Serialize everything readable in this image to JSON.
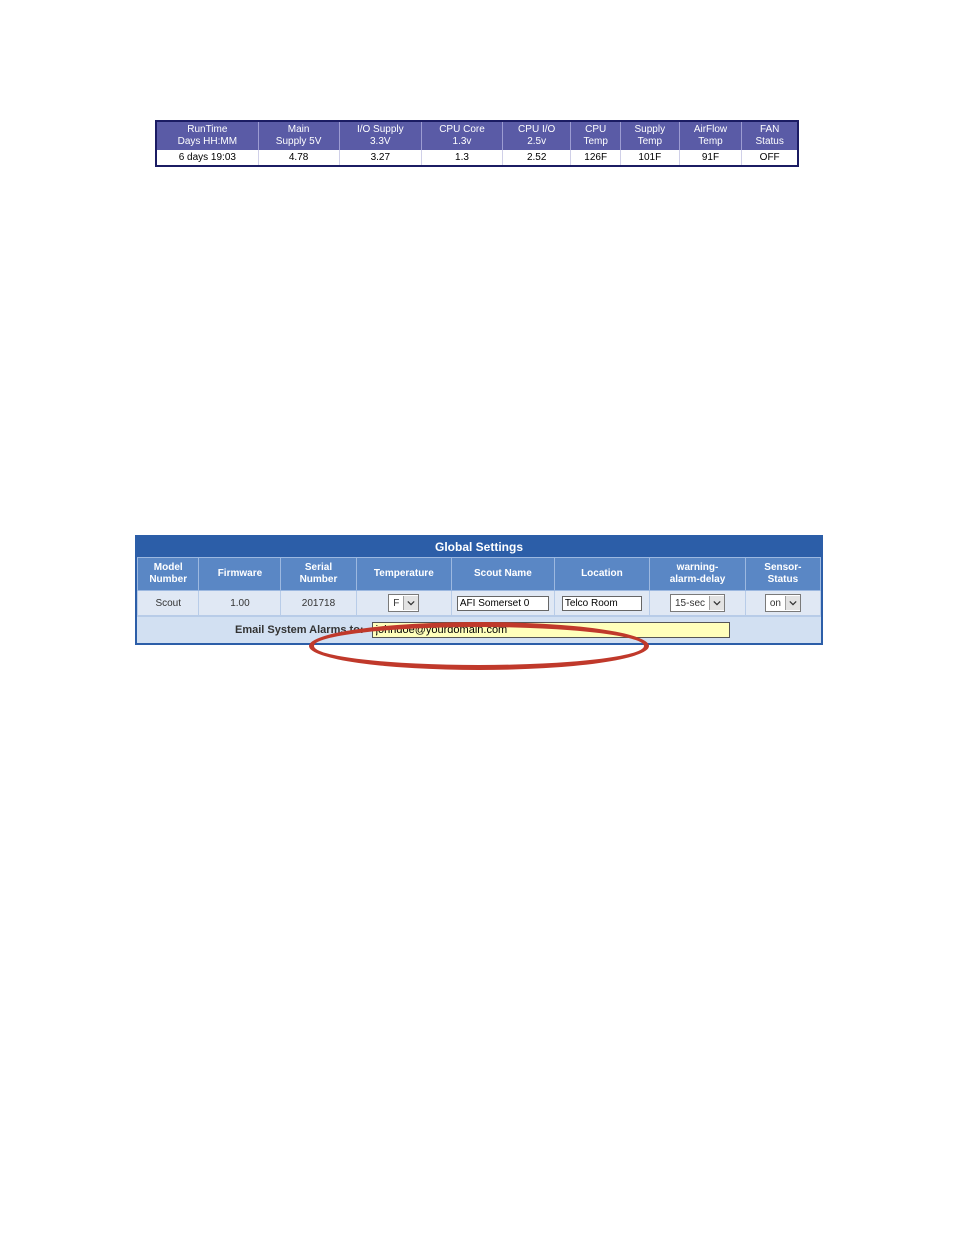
{
  "status_table": {
    "headers": [
      {
        "line1": "RunTime",
        "line2": "Days HH:MM"
      },
      {
        "line1": "Main",
        "line2": "Supply 5V"
      },
      {
        "line1": "I/O Supply",
        "line2": "3.3V"
      },
      {
        "line1": "CPU Core",
        "line2": "1.3v"
      },
      {
        "line1": "CPU I/O",
        "line2": "2.5v"
      },
      {
        "line1": "CPU",
        "line2": "Temp"
      },
      {
        "line1": "Supply",
        "line2": "Temp"
      },
      {
        "line1": "AirFlow",
        "line2": "Temp"
      },
      {
        "line1": "FAN",
        "line2": "Status"
      }
    ],
    "row": [
      "6 days 19:03",
      "4.78",
      "3.27",
      "1.3",
      "2.52",
      "126F",
      "101F",
      "91F",
      "OFF"
    ]
  },
  "global": {
    "title": "Global Settings",
    "headers": [
      {
        "line1": "Model",
        "line2": "Number"
      },
      {
        "line1": "Firmware",
        "line2": ""
      },
      {
        "line1": "Serial",
        "line2": "Number"
      },
      {
        "line1": "Temperature",
        "line2": ""
      },
      {
        "line1": "Scout Name",
        "line2": ""
      },
      {
        "line1": "Location",
        "line2": ""
      },
      {
        "line1": "warning-",
        "line2": "alarm-delay"
      },
      {
        "line1": "Sensor-",
        "line2": "Status"
      }
    ],
    "row": {
      "model": "Scout",
      "firmware": "1.00",
      "serial": "201718",
      "temperature": "F",
      "scout_name": "AFI Somerset 0",
      "location": "Telco Room",
      "delay": "15-sec",
      "sensor_status": "on"
    },
    "email_label": "Email System Alarms to:",
    "email_value": "johndoe@yourdomain.com"
  }
}
